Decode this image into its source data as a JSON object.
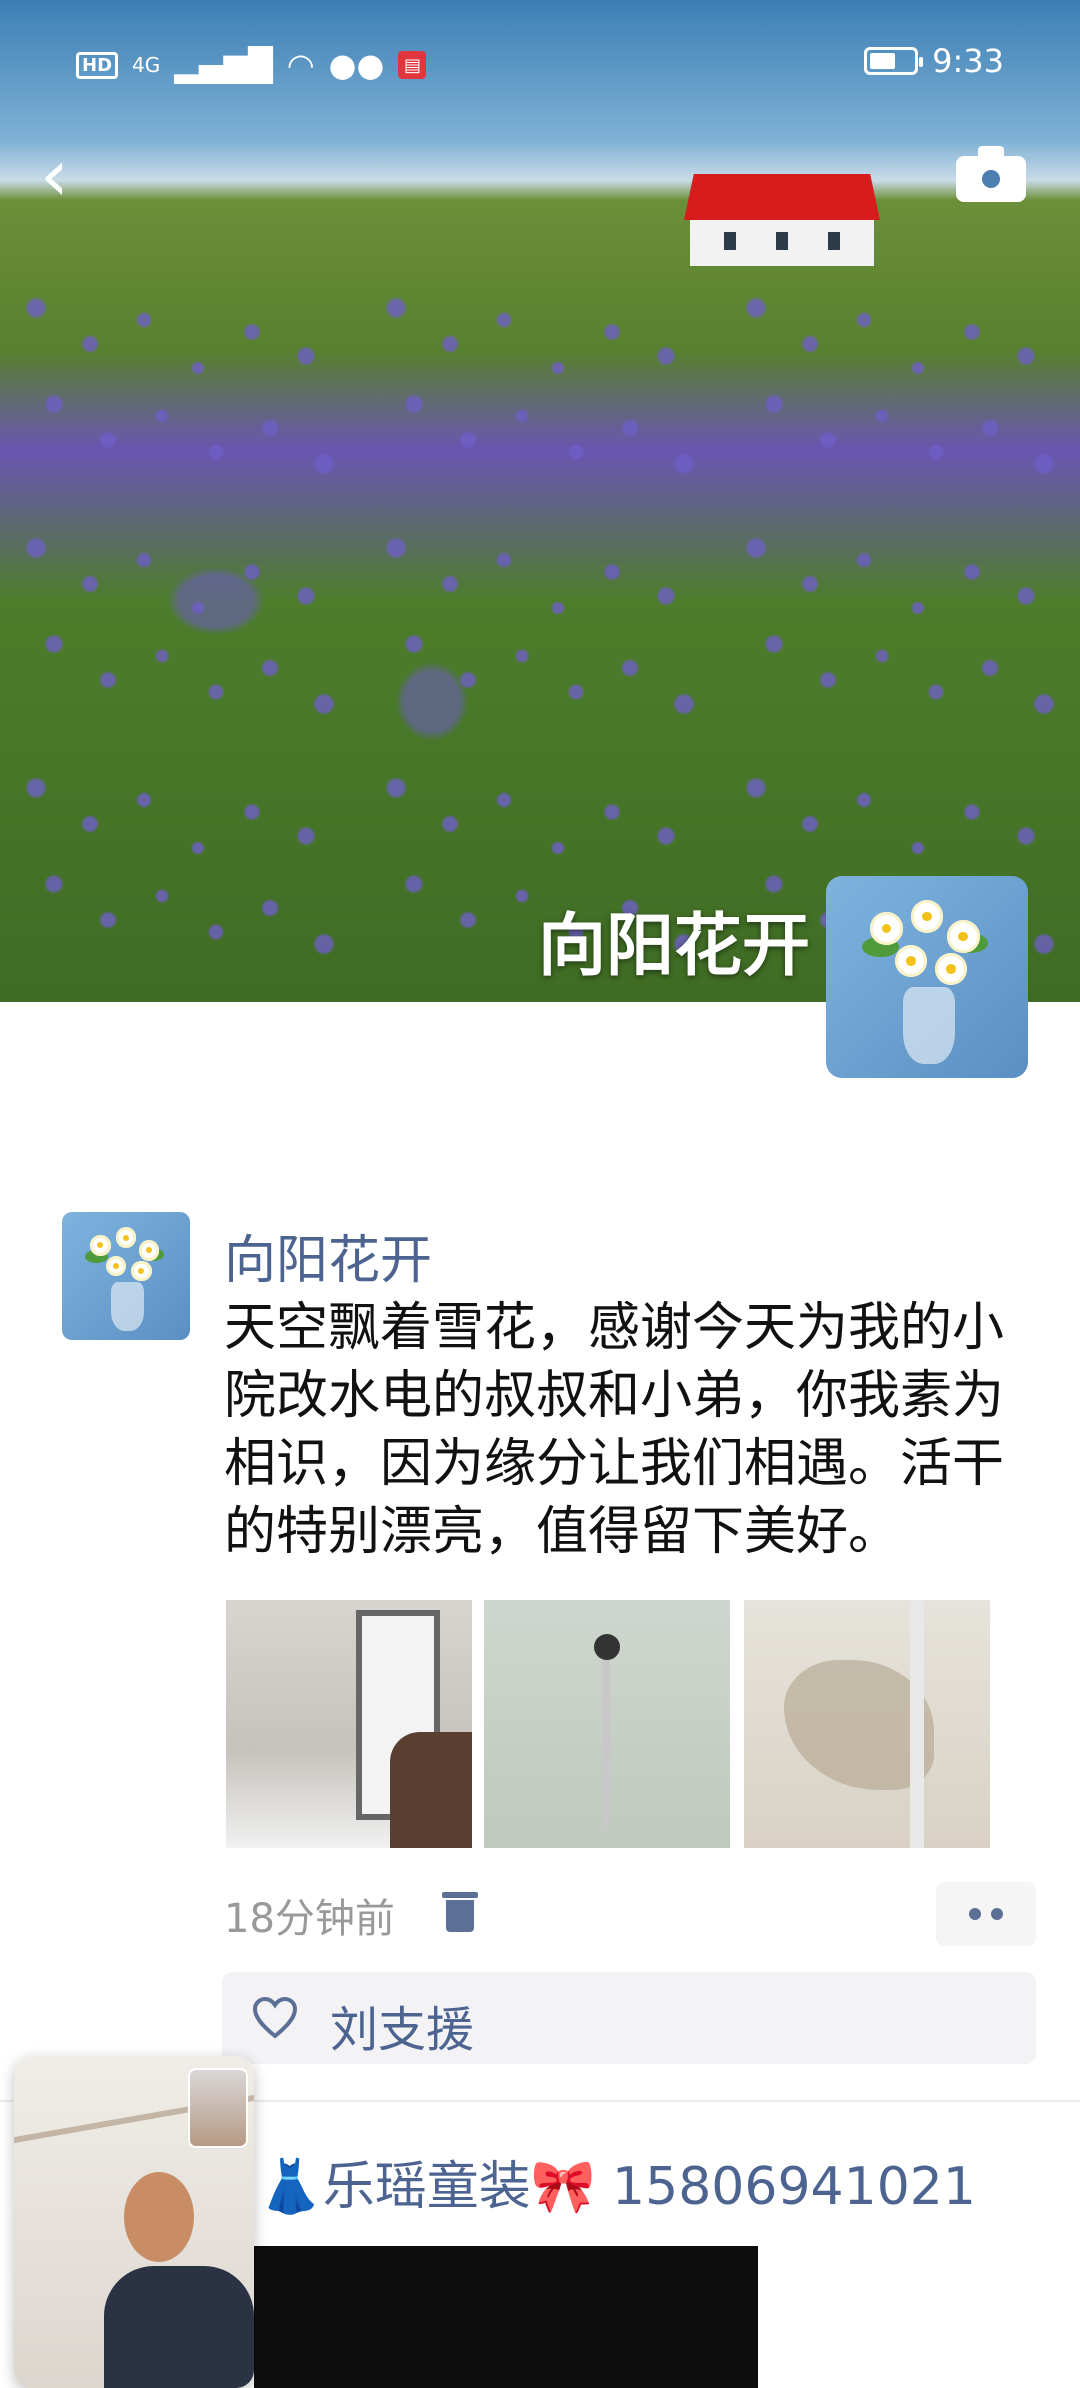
{
  "status_bar": {
    "hd": "HD",
    "network": "4G",
    "time": "9:33",
    "battery_level": 0.6
  },
  "header": {
    "back_icon": "chevron-left-icon",
    "camera_icon": "camera-icon"
  },
  "profile": {
    "name": "向阳花开"
  },
  "post": {
    "author": "向阳花开",
    "text": "天空飘着雪花，感谢今天为我的小院改水电的叔叔和小弟，你我素为相识，因为缘分让我们相遇。活干的特别漂亮，值得留下美好。",
    "photo_count": 3,
    "time_ago": "18分钟前",
    "likes": [
      "刘支援"
    ]
  },
  "next_post": {
    "author": "👗乐瑶童装🎀 15806941021"
  },
  "colors": {
    "link": "#4d6491",
    "icon": "#5c6f96",
    "meta": "#999999"
  }
}
